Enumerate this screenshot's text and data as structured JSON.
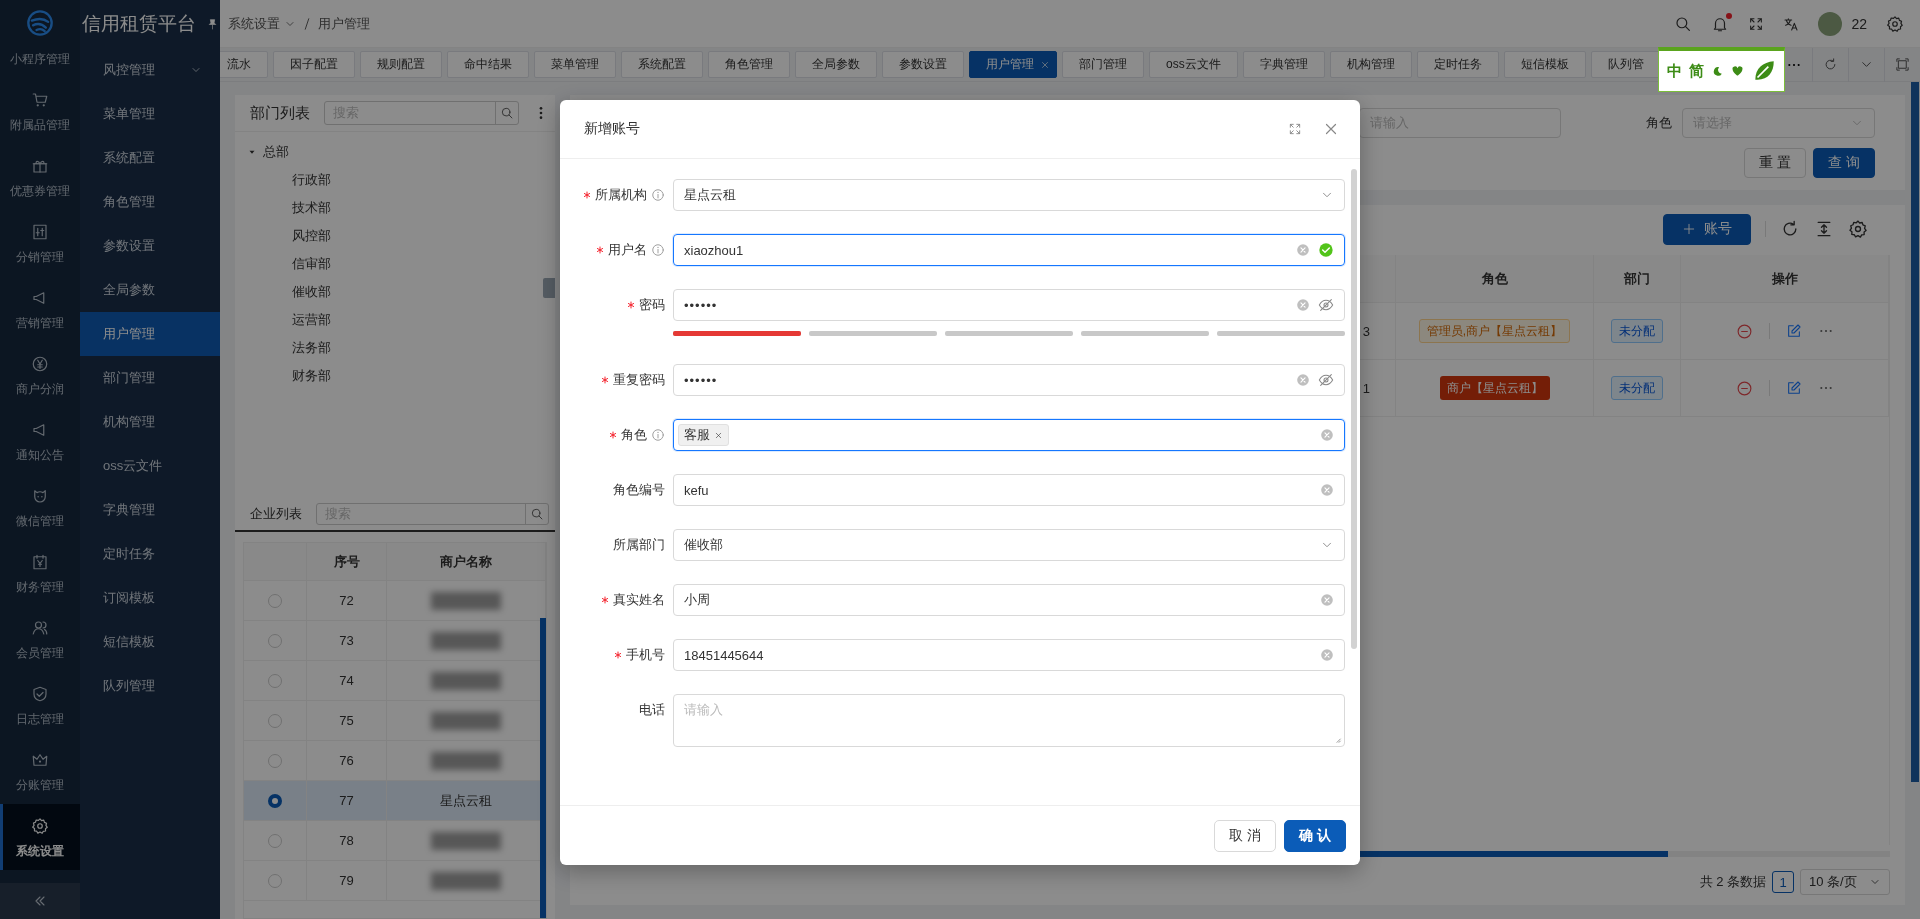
{
  "rail": {
    "items": [
      {
        "label": "小程序管理",
        "selected": false
      },
      {
        "label": "附属品管理",
        "selected": false
      },
      {
        "label": "优惠券管理",
        "selected": false
      },
      {
        "label": "分销管理",
        "selected": false
      },
      {
        "label": "营销管理",
        "selected": false
      },
      {
        "label": "商户分润",
        "selected": false
      },
      {
        "label": "通知公告",
        "selected": false
      },
      {
        "label": "微信管理",
        "selected": false
      },
      {
        "label": "财务管理",
        "selected": false
      },
      {
        "label": "会员管理",
        "selected": false
      },
      {
        "label": "日志管理",
        "selected": false
      },
      {
        "label": "分账管理",
        "selected": false
      },
      {
        "label": "系统设置",
        "selected": true
      }
    ]
  },
  "menu": {
    "title": "信用租赁平台",
    "items": [
      {
        "label": "风控管理",
        "kind": "group",
        "selected": false
      },
      {
        "label": "菜单管理",
        "kind": "item",
        "selected": false
      },
      {
        "label": "系统配置",
        "kind": "item",
        "selected": false
      },
      {
        "label": "角色管理",
        "kind": "item",
        "selected": false
      },
      {
        "label": "参数设置",
        "kind": "item",
        "selected": false
      },
      {
        "label": "全局参数",
        "kind": "item",
        "selected": false
      },
      {
        "label": "用户管理",
        "kind": "item",
        "selected": true
      },
      {
        "label": "部门管理",
        "kind": "item",
        "selected": false
      },
      {
        "label": "机构管理",
        "kind": "item",
        "selected": false
      },
      {
        "label": "oss云文件",
        "kind": "item",
        "selected": false
      },
      {
        "label": "字典管理",
        "kind": "item",
        "selected": false
      },
      {
        "label": "定时任务",
        "kind": "item",
        "selected": false
      },
      {
        "label": "订阅模板",
        "kind": "item",
        "selected": false
      },
      {
        "label": "短信模板",
        "kind": "item",
        "selected": false
      },
      {
        "label": "队列管理",
        "kind": "item",
        "selected": false
      }
    ]
  },
  "header": {
    "breadcrumb": [
      "系统设置",
      "用户管理"
    ],
    "user": "22"
  },
  "tabs": [
    {
      "label": "流水",
      "selected": false
    },
    {
      "label": "因子配置",
      "selected": false
    },
    {
      "label": "规则配置",
      "selected": false
    },
    {
      "label": "命中结果",
      "selected": false
    },
    {
      "label": "菜单管理",
      "selected": false
    },
    {
      "label": "系统配置",
      "selected": false
    },
    {
      "label": "角色管理",
      "selected": false
    },
    {
      "label": "全局参数",
      "selected": false
    },
    {
      "label": "参数设置",
      "selected": false
    },
    {
      "label": "用户管理",
      "selected": true
    },
    {
      "label": "部门管理",
      "selected": false
    },
    {
      "label": "oss云文件",
      "selected": false
    },
    {
      "label": "字典管理",
      "selected": false
    },
    {
      "label": "机构管理",
      "selected": false
    },
    {
      "label": "定时任务",
      "selected": false
    },
    {
      "label": "短信模板",
      "selected": false
    },
    {
      "label": "队列管",
      "selected": false
    }
  ],
  "ime_toolbar": {
    "labels": [
      "中",
      "简"
    ]
  },
  "dept_panel": {
    "title": "部门列表",
    "search_placeholder": "搜索",
    "tree": [
      {
        "label": "总部",
        "expanded": true,
        "children": [
          {
            "label": "行政部"
          },
          {
            "label": "技术部"
          },
          {
            "label": "风控部"
          },
          {
            "label": "信审部"
          },
          {
            "label": "催收部"
          },
          {
            "label": "运营部"
          },
          {
            "label": "法务部"
          },
          {
            "label": "财务部"
          }
        ]
      }
    ]
  },
  "company_panel": {
    "title": "企业列表",
    "search_placeholder": "搜索",
    "columns": [
      "序号",
      "商户名称"
    ],
    "rows": [
      {
        "no": "72",
        "selected": false
      },
      {
        "no": "73",
        "selected": false
      },
      {
        "no": "74",
        "selected": false
      },
      {
        "no": "75",
        "selected": false
      },
      {
        "no": "76",
        "selected": false
      },
      {
        "no": "77",
        "name": "星点云租",
        "selected": true
      },
      {
        "no": "78",
        "selected": false
      },
      {
        "no": "79",
        "selected": false
      }
    ]
  },
  "filter": {
    "input_placeholder": "请输入",
    "role_label": "角色",
    "role_placeholder": "请选择",
    "buttons": [
      {
        "label": "重 置",
        "kind": "default"
      },
      {
        "label": "查 询",
        "kind": "primary"
      }
    ]
  },
  "table": {
    "add_button": "账号",
    "columns": [
      "角色",
      "部门",
      "操作"
    ],
    "rows": [
      {
        "column_1": "3",
        "roles": "管理员,商户【星点云租】",
        "kind": "outline",
        "dept": "未分配"
      },
      {
        "column_1": "1",
        "roles": "商户【星点云租】",
        "kind": "solid",
        "dept": "未分配"
      }
    ]
  },
  "pagination": {
    "total": "共 2 条数据",
    "page": "1",
    "page_size": "10 条/页"
  },
  "modal": {
    "title": "新增账号",
    "fields": [
      {
        "label": "所属机构",
        "kind": "select",
        "required": true,
        "info": true,
        "focused": false,
        "value": "星点云租"
      },
      {
        "label": "用户名",
        "kind": "input",
        "required": true,
        "info": true,
        "focused": true,
        "valid": true,
        "value": "xiaozhou1"
      },
      {
        "label": "密码",
        "kind": "password",
        "required": true,
        "info": false,
        "focused": false,
        "value": "••••••",
        "level": 0.2
      },
      {
        "label": "重复密码",
        "kind": "password",
        "required": true,
        "info": false,
        "focused": false,
        "value": "••••••"
      },
      {
        "label": "角色",
        "kind": "tags",
        "required": true,
        "info": true,
        "focused": true,
        "tags": [
          "客服"
        ]
      },
      {
        "label": "角色编号",
        "kind": "input",
        "required": false,
        "info": false,
        "focused": false,
        "value": "kefu"
      },
      {
        "label": "所属部门",
        "kind": "select",
        "required": false,
        "info": false,
        "focused": false,
        "value": "催收部"
      },
      {
        "label": "真实姓名",
        "kind": "input",
        "required": true,
        "info": false,
        "focused": false,
        "value": "小周"
      },
      {
        "label": "手机号",
        "kind": "input",
        "required": true,
        "info": false,
        "focused": false,
        "value": "18451445644"
      },
      {
        "label": "电话",
        "kind": "textarea",
        "required": false,
        "info": false,
        "focused": false,
        "placeholder": "请输入"
      }
    ],
    "buttons": [
      {
        "label": "取 消",
        "kind": "default"
      },
      {
        "label": "确 认",
        "kind": "primary"
      }
    ]
  }
}
